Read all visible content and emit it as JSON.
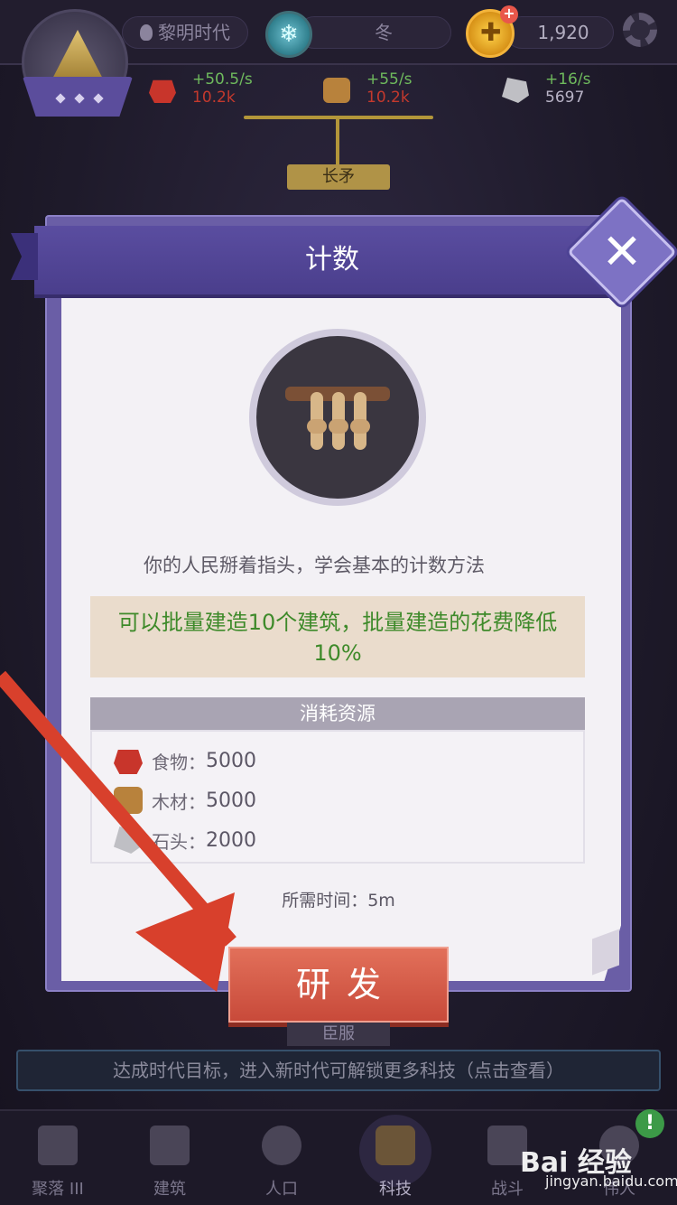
{
  "hud": {
    "era": "黎明时代",
    "season": "冬",
    "gold": "1,920",
    "resources": [
      {
        "rate": "+50.5/s",
        "amount": "10.2k",
        "icon": "food-icon"
      },
      {
        "rate": "+55/s",
        "amount": "10.2k",
        "icon": "wood-icon"
      },
      {
        "rate": "+16/s",
        "amount": "5697",
        "icon": "stone-icon"
      }
    ]
  },
  "tree": {
    "prev_tech": "长矛",
    "next_tech": "臣服"
  },
  "modal": {
    "title": "计数",
    "description": "你的人民掰着指头，学会基本的计数方法",
    "bonus": "可以批量建造10个建筑，批量建造的花费降低10%",
    "cost_header": "消耗资源",
    "costs": [
      {
        "label": "食物：",
        "value": "5000",
        "icon": "food-icon"
      },
      {
        "label": "木材：",
        "value": "5000",
        "icon": "wood-icon"
      },
      {
        "label": "石头：",
        "value": "2000",
        "icon": "stone-icon"
      }
    ],
    "time": "所需时间：5m",
    "research_button": "研发"
  },
  "notice": "达成时代目标，进入新时代可解锁更多科技（点击查看）",
  "nav": {
    "items": [
      {
        "label": "聚落 III"
      },
      {
        "label": "建筑"
      },
      {
        "label": "人口"
      },
      {
        "label": "科技"
      },
      {
        "label": "战斗"
      },
      {
        "label": "伟人"
      }
    ],
    "badge": "!"
  },
  "watermark": {
    "brand": "Bai 经验",
    "url": "jingyan.baidu.com"
  },
  "colors": {
    "accent": "#6a5ea6",
    "button": "#d4503e",
    "bonus_text": "#3e8a2a",
    "arrow": "#d8402c"
  }
}
